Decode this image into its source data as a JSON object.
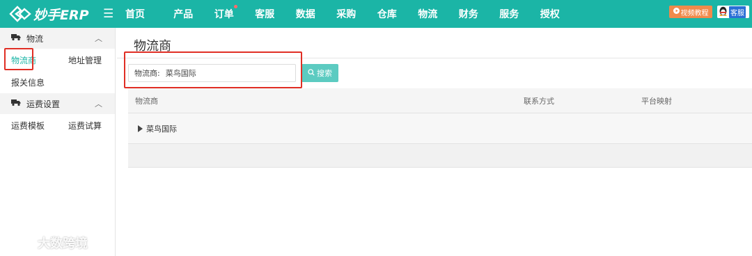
{
  "topbar": {
    "logo_text": "妙手ERP",
    "nav": [
      {
        "label": "首页"
      },
      {
        "label": "产品"
      },
      {
        "label": "订单",
        "dot": true
      },
      {
        "label": "客服"
      },
      {
        "label": "数据"
      },
      {
        "label": "采购"
      },
      {
        "label": "仓库"
      },
      {
        "label": "物流"
      },
      {
        "label": "财务"
      },
      {
        "label": "服务"
      },
      {
        "label": "授权"
      }
    ],
    "video_btn": "视频教程",
    "service_btn": "客服"
  },
  "sidebar": {
    "group1": {
      "title": "物流"
    },
    "items1": [
      {
        "label": "物流商"
      },
      {
        "label": "地址管理"
      },
      {
        "label": "报关信息"
      }
    ],
    "group2": {
      "title": "运费设置"
    },
    "items2": [
      {
        "label": "运费模板"
      },
      {
        "label": "运费试算"
      }
    ]
  },
  "main": {
    "title": "物流商",
    "search": {
      "label": "物流商:",
      "value": "菜鸟国际",
      "button": "搜索"
    },
    "table": {
      "headers": [
        "物流商",
        "联系方式",
        "平台映射"
      ],
      "rows": [
        {
          "name": "菜鸟国际"
        }
      ]
    }
  },
  "watermark": "大数跨境",
  "colors": {
    "brand": "#1bb5a6",
    "highlight": "#e02e24",
    "video": "#f08a4b"
  }
}
